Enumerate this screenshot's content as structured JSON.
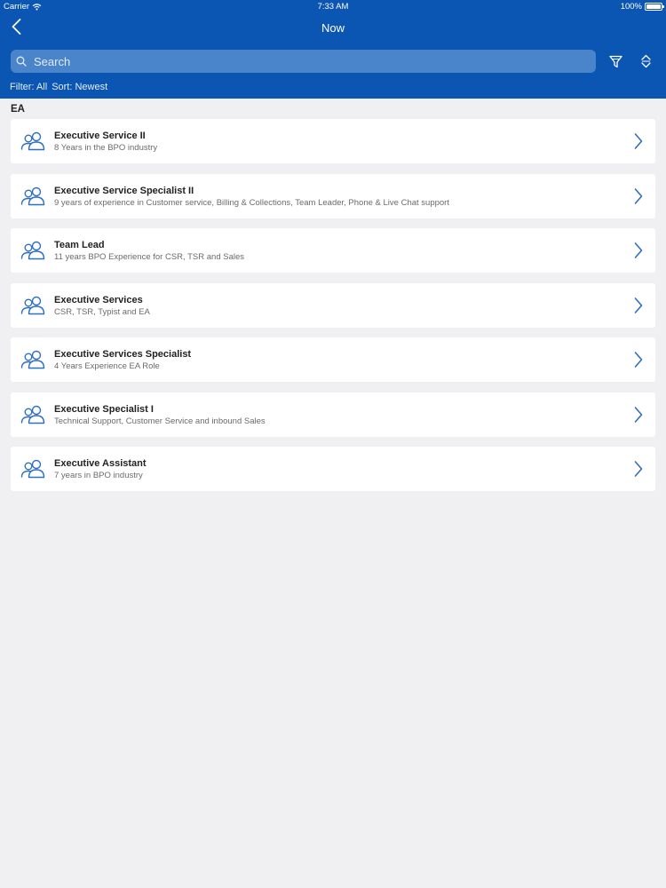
{
  "status_bar": {
    "carrier": "Carrier",
    "time": "7:33 AM",
    "battery": "100%",
    "battery_level": 1.0
  },
  "nav": {
    "title": "Now",
    "back_icon": "chevron-left-icon"
  },
  "search": {
    "placeholder": "Search",
    "value": ""
  },
  "toolbar": {
    "filter_icon": "filter-icon",
    "sort_icon": "sort-icon"
  },
  "filter_line": {
    "filter": "Filter: All",
    "sort": "Sort: Newest"
  },
  "section": {
    "title": "EA"
  },
  "items": [
    {
      "title": "Executive Service II",
      "subtitle": "8 Years in the BPO industry"
    },
    {
      "title": "Executive Service Specialist II",
      "subtitle": "9 years of experience in Customer service,  Billing & Collections, Team Leader, Phone & Live Chat support"
    },
    {
      "title": "Team Lead",
      "subtitle": "11 years BPO Experience for CSR, TSR and Sales"
    },
    {
      "title": "Executive Services",
      "subtitle": "CSR, TSR, Typist and EA"
    },
    {
      "title": "Executive Services Specialist",
      "subtitle": "4 Years Experience EA Role"
    },
    {
      "title": "Executive Specialist I",
      "subtitle": "Technical Support, Customer Service and inbound Sales"
    },
    {
      "title": "Executive Assistant",
      "subtitle": "7 years in BPO industry"
    }
  ],
  "colors": {
    "header_bg": "#0b56b2",
    "search_bg": "#4a84cb",
    "accent": "#2f6fc0",
    "page_bg": "#f0f0f2"
  }
}
